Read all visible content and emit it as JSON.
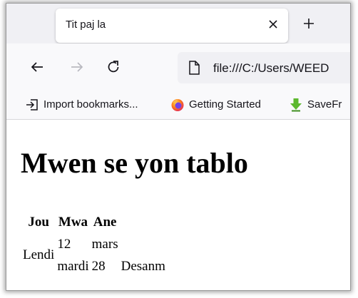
{
  "window": {
    "tab_title": "Tit paj la",
    "address": "file:///C:/Users/WEED"
  },
  "icons": {
    "close": "close-icon",
    "new_tab": "plus-icon",
    "back": "back-arrow-icon",
    "forward": "forward-arrow-icon",
    "reload": "reload-icon",
    "page": "page-icon"
  },
  "bookmarks": [
    {
      "label": "Import bookmarks...",
      "icon": "import-icon"
    },
    {
      "label": "Getting Started",
      "icon": "firefox-icon"
    },
    {
      "label": "SaveFr",
      "icon": "download-arrow-icon"
    }
  ],
  "page": {
    "heading": "Mwen se yon tablo",
    "table": {
      "headers": [
        "Jou",
        "Mwa",
        "Ane"
      ],
      "rows": [
        [
          "Lendi",
          "12",
          "mars",
          ""
        ],
        [
          "",
          "mardi",
          "28",
          "Desanm"
        ]
      ]
    }
  }
}
